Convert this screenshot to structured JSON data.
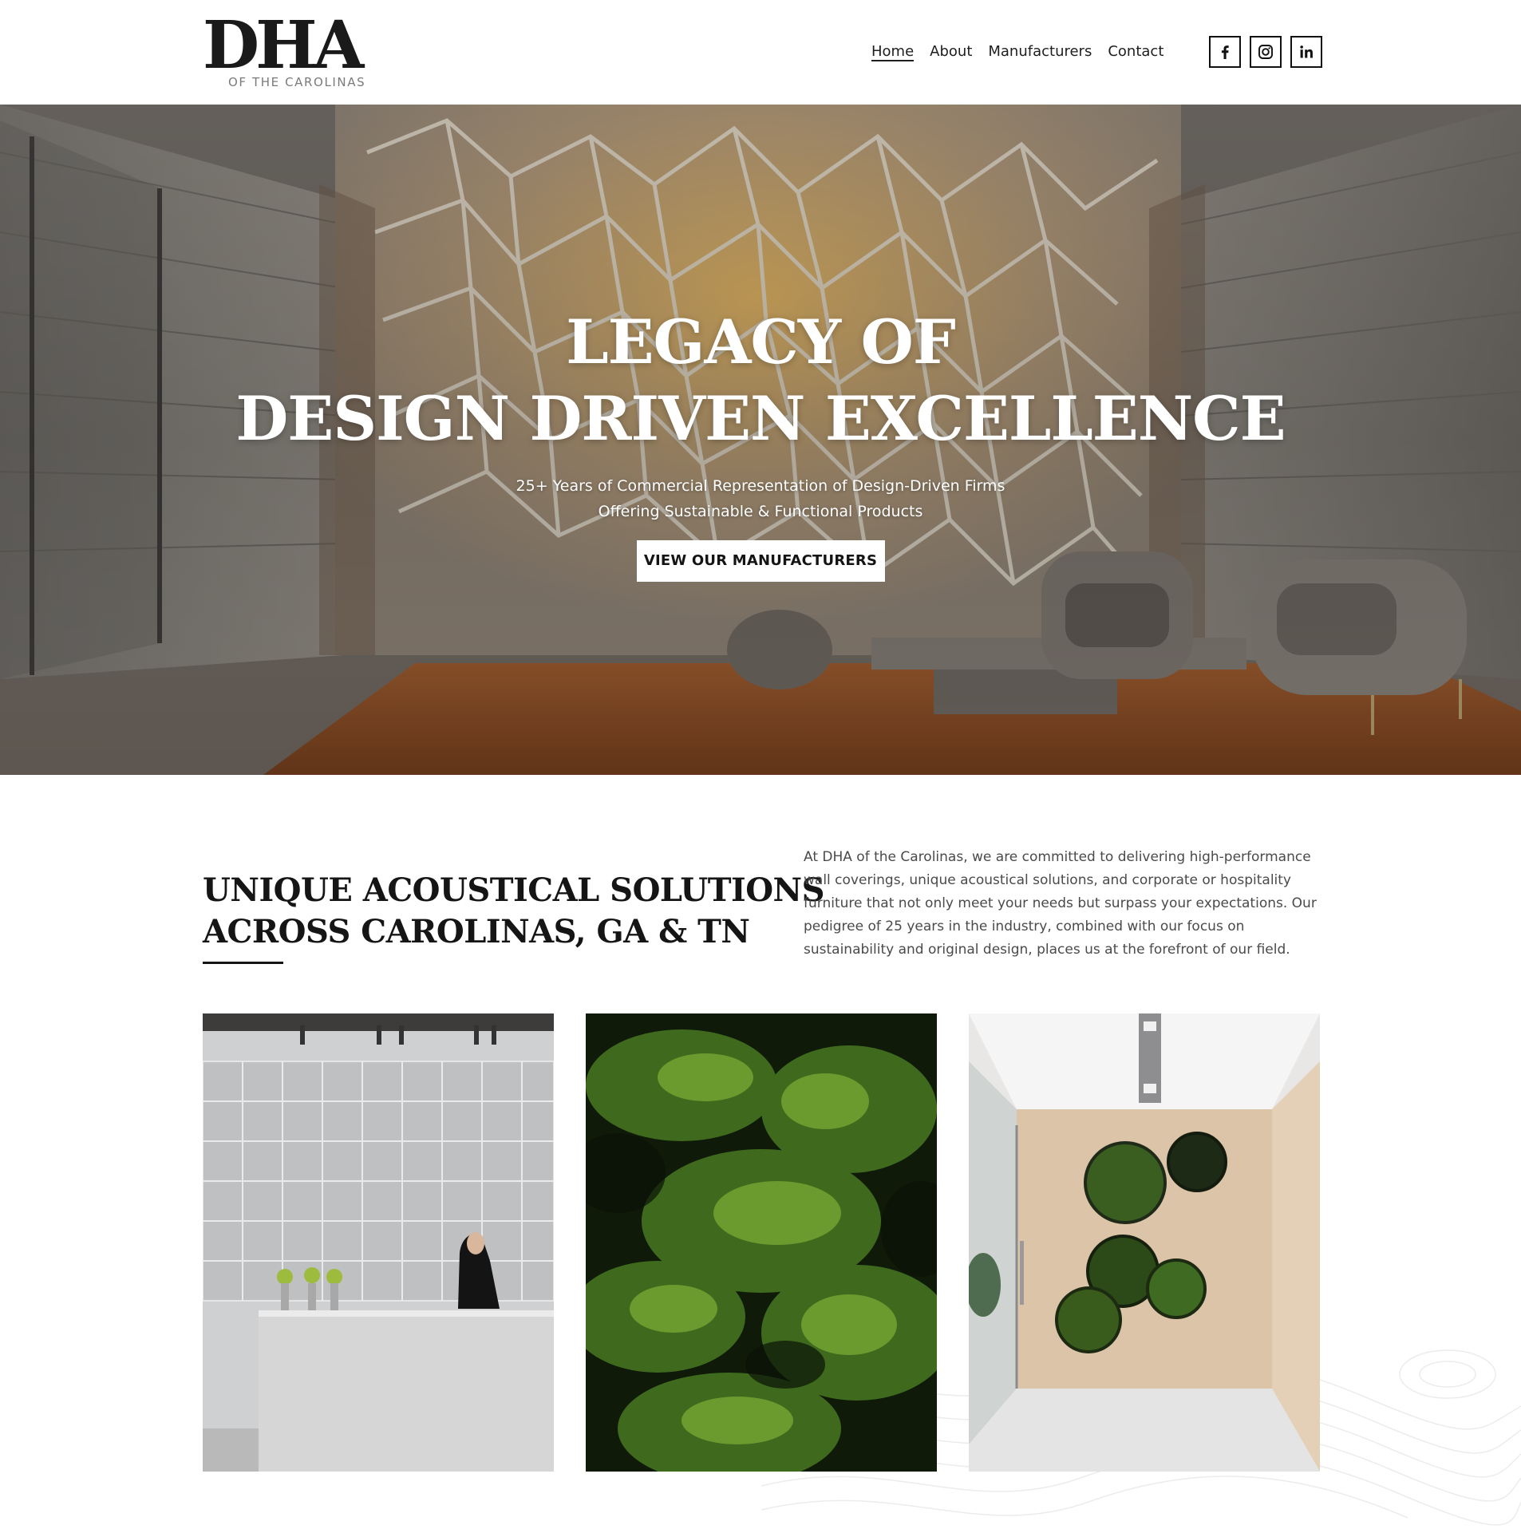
{
  "brand": {
    "logo_text": "DHA",
    "logo_subtitle": "OF THE CAROLINAS"
  },
  "nav": {
    "items": [
      {
        "label": "Home",
        "active": true
      },
      {
        "label": "About",
        "active": false
      },
      {
        "label": "Manufacturers",
        "active": false
      },
      {
        "label": "Contact",
        "active": false
      }
    ]
  },
  "social": {
    "icons": [
      "facebook-icon",
      "instagram-icon",
      "linkedin-icon"
    ]
  },
  "hero": {
    "title_line1": "LEGACY OF",
    "title_line2": "DESIGN DRIVEN EXCELLENCE",
    "subtitle_line1": "25+ Years of Commercial Representation of Design-Driven Firms",
    "subtitle_line2": "Offering Sustainable & Functional Products",
    "cta_label": "VIEW OUR MANUFACTURERS"
  },
  "intro": {
    "heading_line1": "UNIQUE ACOUSTICAL SOLUTIONS",
    "heading_line2": "ACROSS CAROLINAS, GA & TN",
    "body": "At DHA of the Carolinas, we are committed to delivering high-performance wall coverings, unique acoustical solutions, and corporate or hospitality furniture that not only meet your needs but surpass your expectations. Our pedigree of 25 years in the industry, combined with our focus on sustainability and original design, places us at the forefront of our field."
  },
  "colors": {
    "text": "#1e1e1e",
    "muted": "#4a4a4a",
    "hero_overlay": "#6b625a",
    "accent_gold": "#e0b05a",
    "rug": "#8a4a22"
  }
}
